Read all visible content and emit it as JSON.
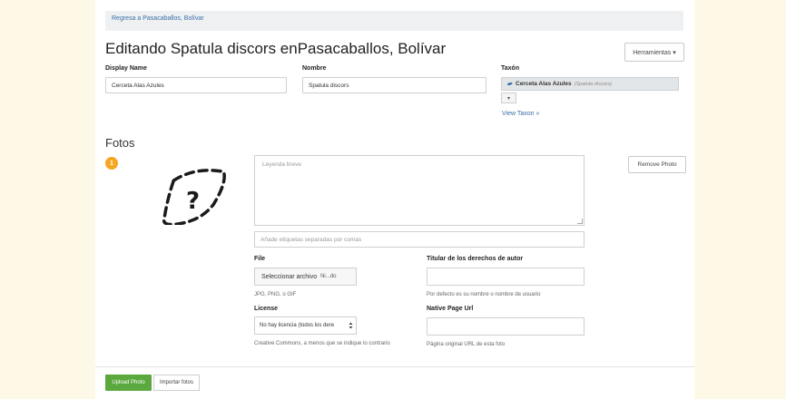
{
  "breadcrumb": {
    "link": "Regresa a Pasacaballos, Bolívar"
  },
  "page_title": "Editando Spatula discors enPasacaballos, Bolívar",
  "tools_button": "Herramientas ▾",
  "fields": {
    "display_name": {
      "label": "Display Name",
      "value": "Cerceta Alas Azules"
    },
    "nombre": {
      "label": "Nombre",
      "value": "Spatula discors"
    },
    "taxon": {
      "label": "Taxón",
      "common": "Cerceta Alas Azules",
      "scientific": "(Spatula discors)",
      "small_button": "▾",
      "view_link": "View Taxon »"
    }
  },
  "photos": {
    "section_title": "Fotos",
    "badge": "1",
    "caption_placeholder": "Leyenda breve",
    "tags_placeholder": "Añade etiquetas separadas por comas",
    "remove_button": "Remove Photo",
    "file": {
      "label": "File",
      "button": "Seleccionar archivo",
      "status": "Ni...do",
      "hint": "JPG, PNG, o GIF"
    },
    "copyright": {
      "label": "Titular de los derechos de autor",
      "hint": "Por defecto es su nombre o nombre de usuario"
    },
    "license": {
      "label": "License",
      "selected": "No hay licencia (todos los dere",
      "hint": "Creative Commons, a menos que se indique lo contrario"
    },
    "native_page": {
      "label": "Native Page Url",
      "hint": "Página original URL de esta foto"
    }
  },
  "footer": {
    "upload_button": "Upload Photo",
    "import_button": "Importar fotos"
  },
  "colors": {
    "accent_green": "#5aa83e",
    "badge_orange": "#f5a623",
    "link_blue": "#3a6fa6"
  }
}
